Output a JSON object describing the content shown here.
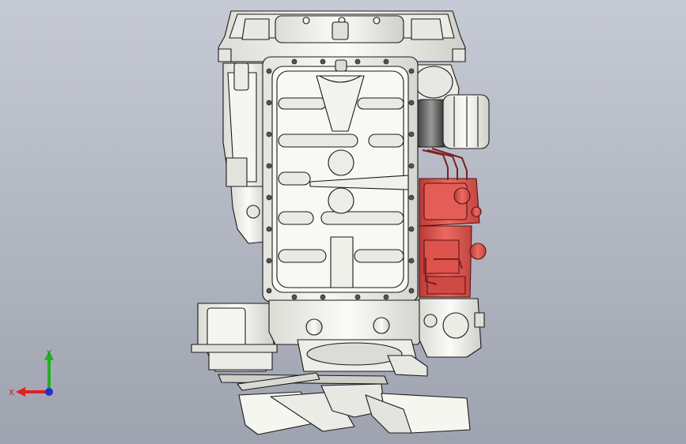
{
  "viewport": {
    "background_top": "#c6cad4",
    "background_bottom": "#9ea3af"
  },
  "model": {
    "part_fill": "#f2f2ee",
    "part_shade": "#d8d8d2",
    "edge_color": "#1a1a1a",
    "highlight_fill": "#e25a55",
    "highlight_shade": "#b93a37"
  },
  "triad": {
    "x_label": "X",
    "y_label": "Y",
    "x_color": "#e02020",
    "y_color": "#20b020",
    "z_color": "#2030d0"
  }
}
